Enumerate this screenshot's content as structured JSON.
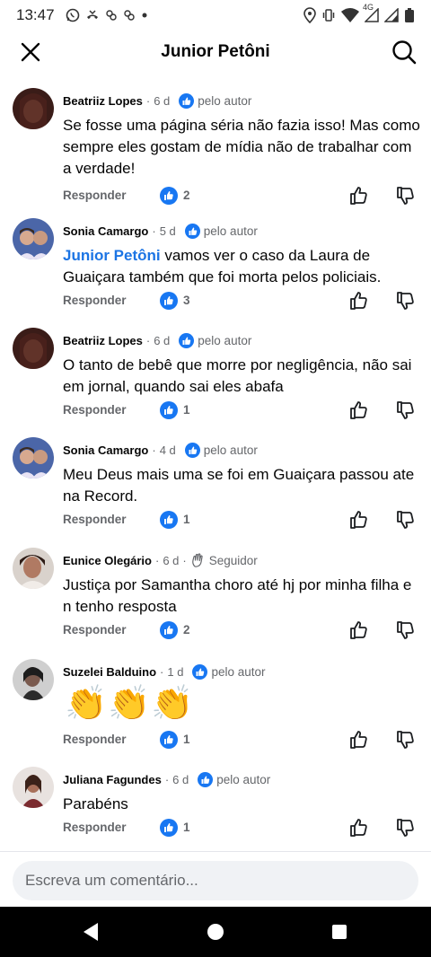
{
  "status_bar": {
    "time": "13:47",
    "network_label": "4G",
    "left_icons": [
      "whatsapp-icon",
      "missed-call-icon",
      "app-notification-icon",
      "app-notification-icon",
      "dot-icon"
    ],
    "right_icons": [
      "location-icon",
      "vibrate-icon",
      "wifi-icon",
      "signal-icon",
      "signal-icon",
      "battery-icon"
    ]
  },
  "header": {
    "title": "Junior Petôni",
    "close_icon": "close-icon",
    "search_icon": "search-icon"
  },
  "comments": [
    {
      "author": "Beatriiz Lopes",
      "time": "6 d",
      "badge": "pelo autor",
      "badge_icon": "like-badge-icon",
      "text": "Se fosse uma página séria não fazia isso! Mas como sempre eles gostam de mídia não de trabalhar com a verdade!",
      "reply_label": "Responder",
      "likes": "2",
      "avatar_color": "#5a2b24"
    },
    {
      "author": "Sonia Camargo",
      "time": "5 d",
      "badge": "pelo autor",
      "badge_icon": "like-badge-icon",
      "mention": "Junior Petôni",
      "text": " vamos ver o caso da Laura de Guaiçara também que foi morta pelos policiais.",
      "reply_label": "Responder",
      "likes": "3",
      "avatar_color": "#6d87c2"
    },
    {
      "author": "Beatriiz Lopes",
      "time": "6 d",
      "badge": "pelo autor",
      "badge_icon": "like-badge-icon",
      "text": "O tanto de bebê que morre por negligência, não sai em jornal, quando sai eles abafa",
      "reply_label": "Responder",
      "likes": "1",
      "avatar_color": "#5a2b24"
    },
    {
      "author": "Sonia Camargo",
      "time": "4 d",
      "badge": "pelo autor",
      "badge_icon": "like-badge-icon",
      "text": "Meu Deus mais uma se foi em Guaiçara passou ate na Record.",
      "reply_label": "Responder",
      "likes": "1",
      "avatar_color": "#6d87c2"
    },
    {
      "author": "Eunice Olegário",
      "time": "6 d",
      "badge": "Seguidor",
      "badge_icon": "wave-icon",
      "text": "Justiça por Samantha choro até hj por minha filha e n tenho resposta",
      "reply_label": "Responder",
      "likes": "2",
      "avatar_color": "#8a5a4e"
    },
    {
      "author": "Suzelei Balduino",
      "time": "1 d",
      "badge": "pelo autor",
      "badge_icon": "like-badge-icon",
      "emoji": [
        "👏",
        "👏",
        "👏"
      ],
      "reply_label": "Responder",
      "likes": "1",
      "avatar_color": "#3d3d3d"
    },
    {
      "author": "Juliana Fagundes",
      "time": "6 d",
      "badge": "pelo autor",
      "badge_icon": "like-badge-icon",
      "text": "Parabéns",
      "reply_label": "Responder",
      "likes": "1",
      "avatar_color": "#b99a8c"
    }
  ],
  "composer": {
    "placeholder": "Escreva um comentário..."
  },
  "nav_bar": {
    "icons": [
      "back-icon",
      "home-icon",
      "recents-icon"
    ]
  },
  "colors": {
    "accent": "#1877f2",
    "mention": "#1b74e4",
    "secondary_text": "#65676b"
  }
}
